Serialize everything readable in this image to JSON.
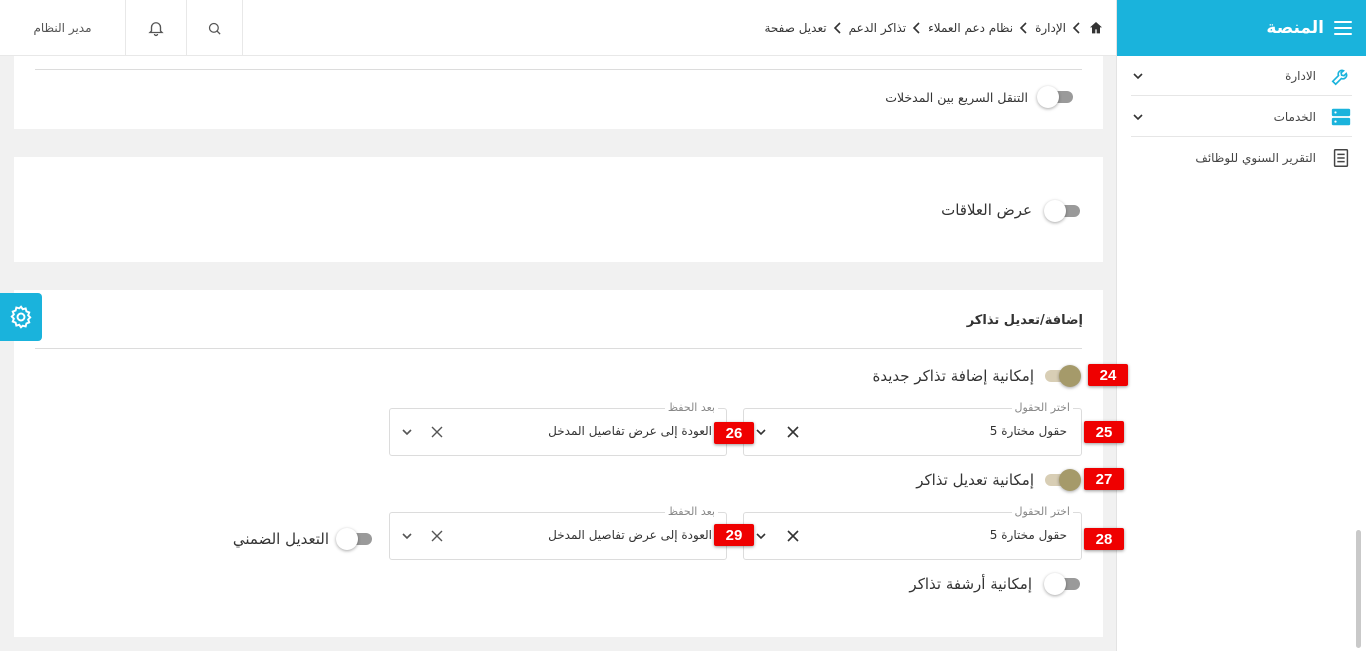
{
  "sidebar": {
    "brand": "المنصة",
    "items": [
      {
        "label": "الادارة",
        "icon": "wrench-icon"
      },
      {
        "label": "الخدمات",
        "icon": "server-icon"
      },
      {
        "label": "التقرير السنوي للوظائف",
        "icon": "document-icon"
      }
    ]
  },
  "topbar": {
    "user": "مدير النظام",
    "breadcrumb": [
      "الإدارة",
      "نظام دعم العملاء",
      "تذاكر الدعم",
      "تعديل صفحة"
    ]
  },
  "cards": {
    "quick_nav_label": "التنقل السريع بين المدخلات",
    "relations_label": "عرض العلاقات",
    "section_title": "إضافة/تعديل تذاكر",
    "add_tickets_label": "إمكانية إضافة تذاكر جديدة",
    "edit_tickets_label": "إمكانية تعديل تذاكر",
    "archive_tickets_label": "إمكانية أرشفة تذاكر",
    "inline_edit_label": "التعديل الضمني"
  },
  "fields": {
    "fields_legend": "اختر الحقول",
    "fields_value": "5 حقول مختارة",
    "after_save_legend": "بعد الحفظ",
    "after_save_value": "العودة إلى عرض تفاصيل المدخل"
  },
  "badges": [
    "24",
    "25",
    "26",
    "27",
    "28",
    "29"
  ],
  "colors": {
    "brand": "#1ab3dc",
    "badge": "#ef0000",
    "toggle_on": "#a59a6a"
  }
}
